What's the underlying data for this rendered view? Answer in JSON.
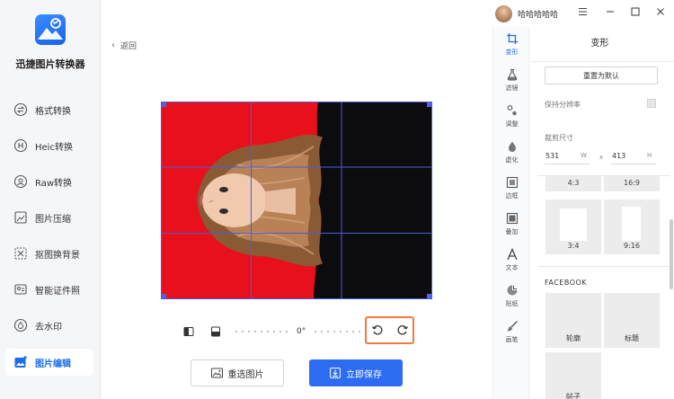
{
  "app": {
    "name": "迅捷图片转换器"
  },
  "user": {
    "name": "哈哈哈哈哈"
  },
  "sidebar": {
    "items": [
      {
        "label": "格式转换",
        "icon": "format-convert-icon"
      },
      {
        "label": "Heic转换",
        "icon": "heic-icon"
      },
      {
        "label": "Raw转换",
        "icon": "raw-icon"
      },
      {
        "label": "图片压缩",
        "icon": "compress-icon"
      },
      {
        "label": "抠图换背景",
        "icon": "cutout-icon"
      },
      {
        "label": "智能证件照",
        "icon": "id-photo-icon"
      },
      {
        "label": "去水印",
        "icon": "watermark-icon"
      },
      {
        "label": "图片编辑",
        "icon": "image-edit-icon",
        "active": true
      }
    ]
  },
  "editor": {
    "back_label": "返回",
    "rotation_label": "0°",
    "reselect_label": "重选图片",
    "save_label": "立即保存"
  },
  "tools": [
    {
      "label": "变形",
      "icon": "transform-icon",
      "active": true
    },
    {
      "label": "滤镜",
      "icon": "filter-icon"
    },
    {
      "label": "调整",
      "icon": "adjust-icon"
    },
    {
      "label": "虚化",
      "icon": "blur-icon"
    },
    {
      "label": "边框",
      "icon": "border-icon"
    },
    {
      "label": "叠加",
      "icon": "overlay-icon"
    },
    {
      "label": "文本",
      "icon": "text-icon"
    },
    {
      "label": "贴纸",
      "icon": "sticker-icon"
    },
    {
      "label": "画笔",
      "icon": "brush-icon"
    }
  ],
  "panel": {
    "title": "变形",
    "reset_label": "重置为默认",
    "keep_resolution_label": "保持分辨率",
    "keep_resolution_checked": false,
    "crop_size_label": "裁剪尺寸",
    "width_value": "531",
    "width_unit": "W",
    "times": "x",
    "height_value": "413",
    "height_unit": "H",
    "ratios": [
      "4:3",
      "16:9",
      "3:4",
      "9:16"
    ],
    "facebook_title": "FACEBOOK",
    "facebook_items": [
      "轮廓",
      "标题",
      "帖子"
    ]
  },
  "colors": {
    "accent": "#2c6cf0",
    "photo_background": "#e8101c",
    "highlight": "#f07a3e"
  }
}
